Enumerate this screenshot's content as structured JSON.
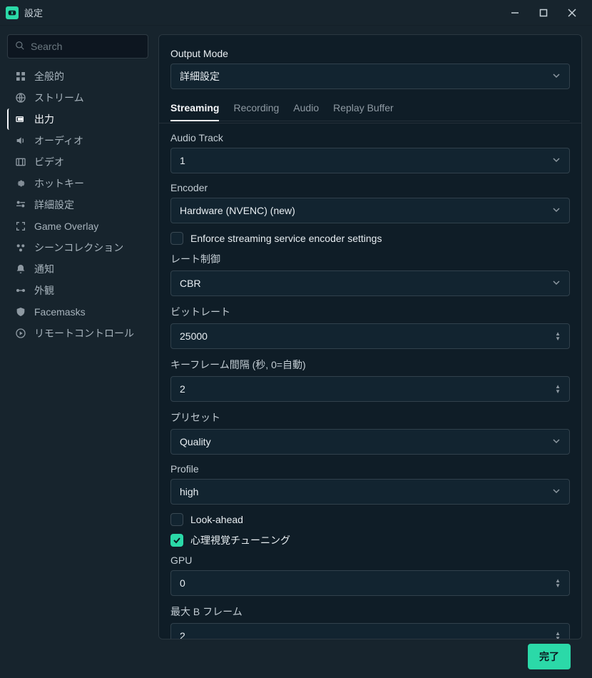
{
  "window": {
    "title": "設定"
  },
  "sidebar": {
    "search_placeholder": "Search",
    "items": [
      {
        "label": "全般的",
        "icon": "grid-icon"
      },
      {
        "label": "ストリーム",
        "icon": "globe-icon"
      },
      {
        "label": "出力",
        "icon": "output-icon"
      },
      {
        "label": "オーディオ",
        "icon": "volume-icon"
      },
      {
        "label": "ビデオ",
        "icon": "film-icon"
      },
      {
        "label": "ホットキー",
        "icon": "gear-icon"
      },
      {
        "label": "詳細設定",
        "icon": "sliders-icon"
      },
      {
        "label": "Game Overlay",
        "icon": "expand-icon"
      },
      {
        "label": "シーンコレクション",
        "icon": "collection-icon"
      },
      {
        "label": "通知",
        "icon": "bell-icon"
      },
      {
        "label": "外観",
        "icon": "appearance-icon"
      },
      {
        "label": "Facemasks",
        "icon": "shield-icon"
      },
      {
        "label": "リモートコントロール",
        "icon": "play-icon"
      }
    ],
    "active_index": 2
  },
  "content": {
    "output_mode_label": "Output Mode",
    "output_mode_value": "詳細設定",
    "tabs": [
      "Streaming",
      "Recording",
      "Audio",
      "Replay Buffer"
    ],
    "active_tab": 0,
    "audio_track_label": "Audio Track",
    "audio_track_value": "1",
    "encoder_label": "Encoder",
    "encoder_value": "Hardware (NVENC) (new)",
    "enforce_label": "Enforce streaming service encoder settings",
    "enforce_checked": false,
    "rate_control_label": "レート制御",
    "rate_control_value": "CBR",
    "bitrate_label": "ビットレート",
    "bitrate_value": "25000",
    "keyframe_label": "キーフレーム間隔 (秒, 0=自動)",
    "keyframe_value": "2",
    "preset_label": "プリセット",
    "preset_value": "Quality",
    "profile_label": "Profile",
    "profile_value": "high",
    "lookahead_label": "Look-ahead",
    "lookahead_checked": false,
    "psycho_label": "心理視覚チューニング",
    "psycho_checked": true,
    "gpu_label": "GPU",
    "gpu_value": "0",
    "bframes_label": "最大 B フレーム",
    "bframes_value": "2"
  },
  "footer": {
    "done_label": "完了"
  }
}
